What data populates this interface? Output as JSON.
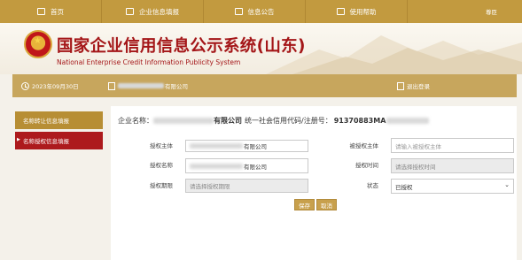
{
  "nav": {
    "home": "首页",
    "fill": "企业信息填报",
    "notice": "信息公告",
    "help": "使用帮助",
    "login": "尊臣"
  },
  "header": {
    "title_cn": "国家企业信用信息公示系统(山东)",
    "title_en": "National Enterprise Credit Information Publicity System"
  },
  "infobar": {
    "date": "2023年09月30日",
    "company_suffix": "有限公司",
    "logout": "退出登录"
  },
  "sidebar": {
    "items": [
      {
        "label": "名称转让信息填报"
      },
      {
        "label": "名称授权信息填报"
      }
    ]
  },
  "form": {
    "enterprise_name_label": "企业名称：",
    "enterprise_name_suffix": "有限公司",
    "credit_code_label": "统一社会信用代码/注册号：",
    "credit_code": "91370883MA",
    "grantor_label": "授权主体",
    "grantor_value_suffix": "有限公司",
    "grantee_label": "被授权主体",
    "grantee_placeholder": "请输入被授权主体",
    "name_label": "授权名称",
    "name_value_suffix": "有限公司",
    "time_label": "授权时间",
    "time_placeholder": "请选择授权时间",
    "period_label": "授权期限",
    "period_placeholder": "请选择授权期限",
    "status_label": "状态",
    "status_value": "已授权",
    "save": "保存",
    "cancel": "取消"
  }
}
